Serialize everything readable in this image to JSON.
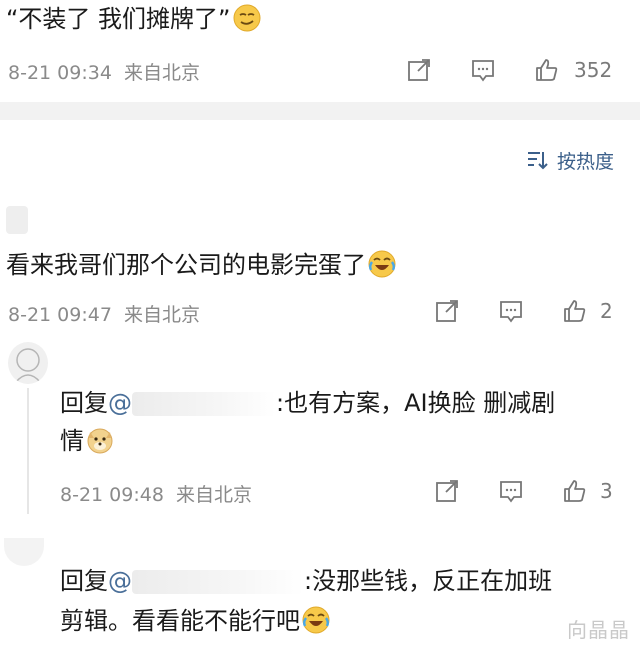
{
  "top_comment": {
    "text": "“不装了 我们摊牌了”",
    "emoji": "smirk-emoji",
    "time": "8-21 09:34",
    "source": "来自北京",
    "likes": "352"
  },
  "sort": {
    "label": "按热度",
    "icon": "sort-icon"
  },
  "comment_2": {
    "text": "看来我哥们那个公司的电影完蛋了",
    "emoji": "laugh-cry-emoji",
    "time": "8-21 09:47",
    "source": "来自北京",
    "likes": "2"
  },
  "reply_1": {
    "prefix": "回复",
    "mention": "@",
    "text_line1": ":也有方案，AI换脸 删减剧",
    "text_line2": "情",
    "emoji": "doge-emoji",
    "time": "8-21 09:48",
    "source": "来自北京",
    "likes": "3"
  },
  "reply_2": {
    "prefix": "回复",
    "mention": "@",
    "text_line1": ":没那些钱，反正在加班",
    "text_line2": "剪辑。看看能不能行吧",
    "emoji": "laugh-cry-emoji"
  },
  "watermark": "向晶晶",
  "colors": {
    "link": "#3b5f8a",
    "meta": "#8a8a8a",
    "divider": "#f2f2f2"
  }
}
